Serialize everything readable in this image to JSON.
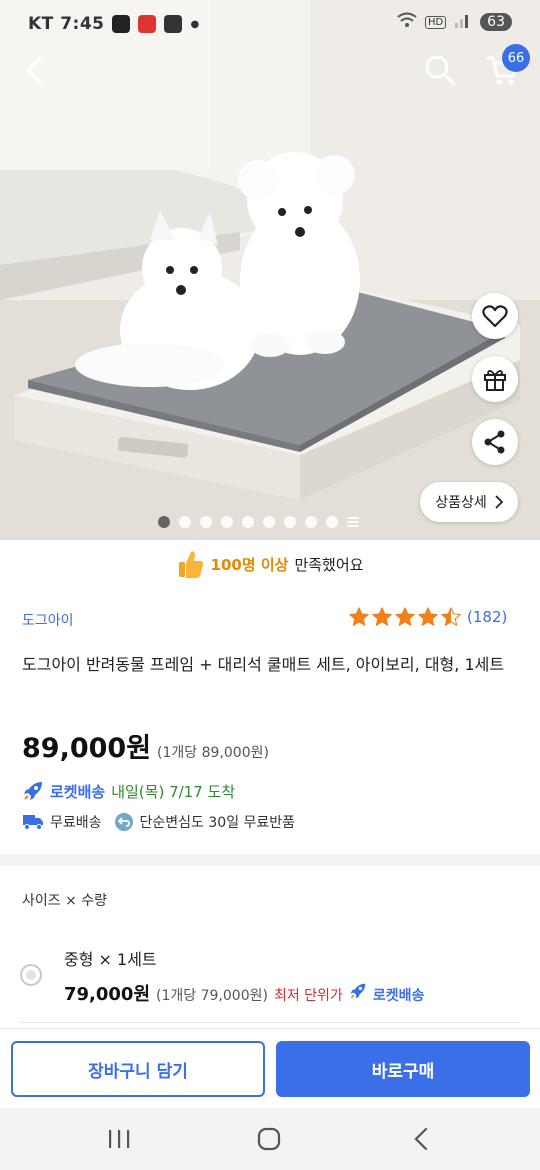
{
  "status_bar": {
    "carrier_time": "KT 7:45",
    "battery": "63"
  },
  "header": {
    "cart_badge": "66"
  },
  "hero": {
    "detail_button_label": "상품상세",
    "dot_count": 10,
    "active_dot": 0
  },
  "satisfaction": {
    "highlight": "100명 이상",
    "rest": "만족했어요"
  },
  "product": {
    "brand": "도그아이",
    "rating": 4.5,
    "rating_count": "(182)",
    "title": "도그아이 반려동물 프레임 + 대리석 쿨매트 세트, 아이보리, 대형, 1세트",
    "price": "89,000원",
    "unit_price": "(1개당 89,000원)",
    "rocket_label": "로켓배송",
    "delivery_date": "내일(목) 7/17 도착",
    "free_shipping": "무료배송",
    "free_return": "단순변심도 30일 무료반품"
  },
  "options": {
    "header": "사이즈 × 수량",
    "items": [
      {
        "name": "중형 × 1세트",
        "price": "79,000원",
        "unit_price": "(1개당 79,000원)",
        "lowest_tag": "최저 단위가",
        "rocket": "로켓배송"
      }
    ]
  },
  "actions": {
    "cart_label": "장바구니 담기",
    "buy_label": "바로구매"
  },
  "colors": {
    "accent": "#3a6fe8",
    "star": "#f0811a",
    "lowest": "#d42c2c",
    "delivery": "#2f8a2f"
  }
}
